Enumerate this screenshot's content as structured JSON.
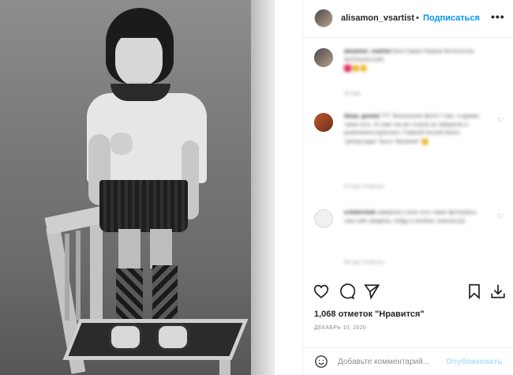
{
  "post": {
    "username": "alisamon_vsartist",
    "follow_label": "Подписаться",
    "separator": "•",
    "more_label": "•••"
  },
  "comments": [
    {
      "author": "alisamon_vsartist",
      "text": "Моя Самая Первая Фотосессия ФОТОСЕССИЯ",
      "meta": "54 нед."
    },
    {
      "author": "tanya_gusma",
      "text": "??? Эпохальное фото! У вас, я думаю, такие есть. Я тоже так же стояла на табуретке и развлекала взрослых. Главной песней моего \"репертуара\" было \"Валенки\"",
      "meta": "57 нед.    Ответить"
    },
    {
      "author": "a.fedorchuk",
      "text": "наверное у всех есть такие фото)(весь наш сайт увидела, побду в альбом, поискать)))",
      "meta": "55 нед.    Ответить"
    }
  ],
  "stats": {
    "likes": "1,068 отметок \"Нравится\"",
    "date": "ДЕКАБРЬ 10, 2020"
  },
  "composer": {
    "placeholder": "Добавьте комментарий...",
    "publish_label": "Опубликовать"
  }
}
